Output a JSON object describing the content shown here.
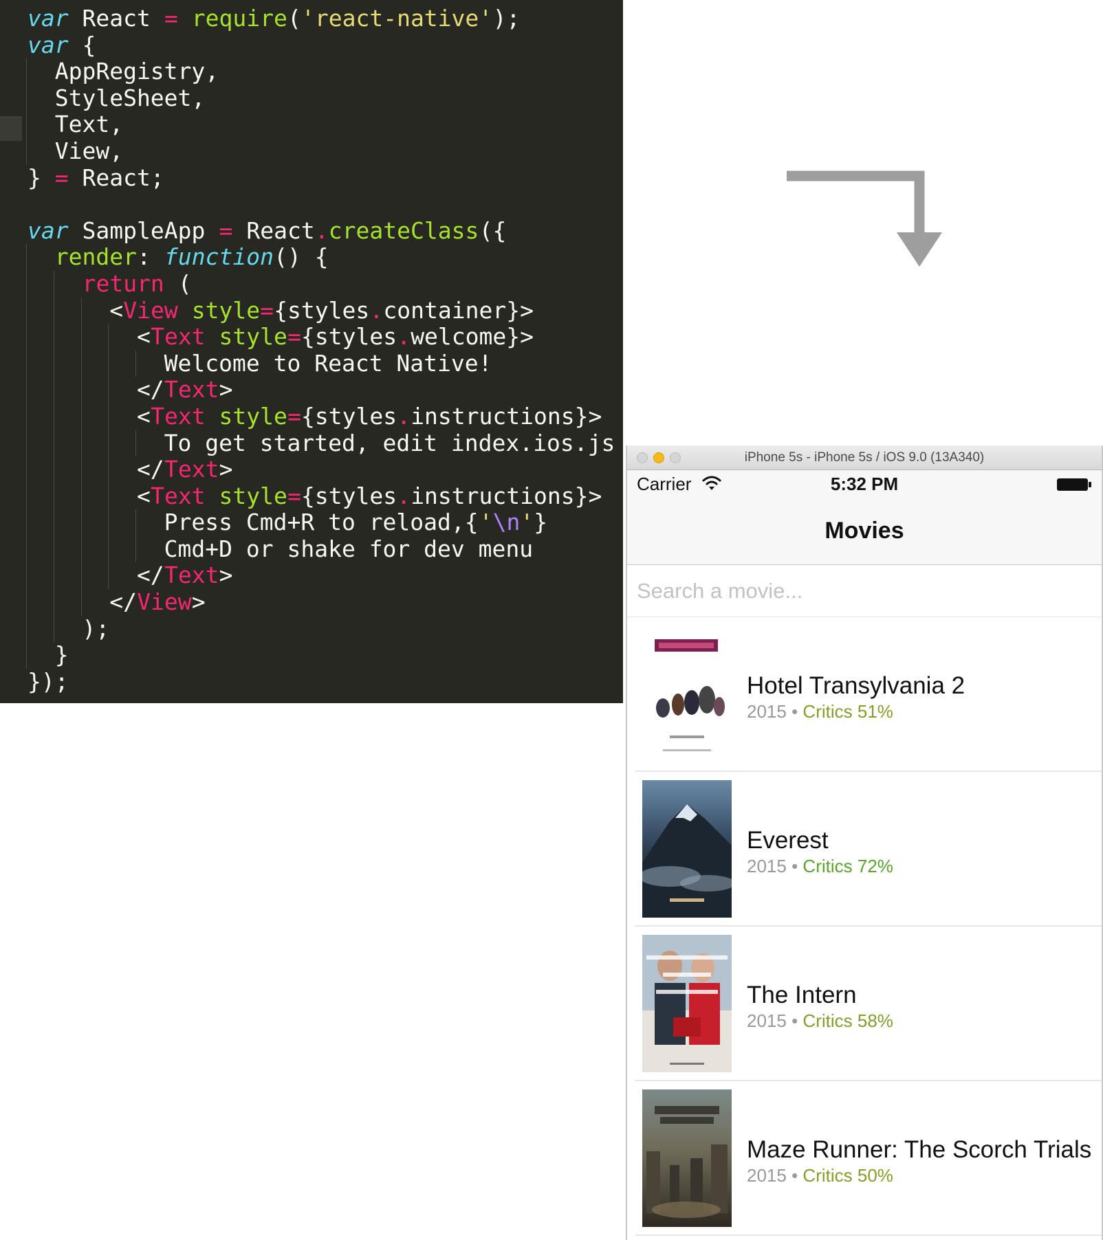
{
  "editor": {
    "lines": [
      [
        {
          "t": "var",
          "c": "kw-it"
        },
        {
          "t": " React ",
          "c": "plain"
        },
        {
          "t": "=",
          "c": "op"
        },
        {
          "t": " require",
          "c": "fn"
        },
        {
          "t": "(",
          "c": "plain"
        },
        {
          "t": "'react-native'",
          "c": "str"
        },
        {
          "t": ");",
          "c": "plain"
        }
      ],
      [
        {
          "t": "var",
          "c": "kw-it"
        },
        {
          "t": " {",
          "c": "plain"
        }
      ],
      [
        {
          "t": "  AppRegistry,",
          "c": "plain"
        }
      ],
      [
        {
          "t": "  StyleSheet,",
          "c": "plain"
        }
      ],
      [
        {
          "t": "  Text,",
          "c": "plain"
        }
      ],
      [
        {
          "t": "  View,",
          "c": "plain"
        }
      ],
      [
        {
          "t": "} ",
          "c": "plain"
        },
        {
          "t": "=",
          "c": "op"
        },
        {
          "t": " React;",
          "c": "plain"
        }
      ],
      [
        {
          "t": "",
          "c": "plain"
        }
      ],
      [
        {
          "t": "var",
          "c": "kw-it"
        },
        {
          "t": " SampleApp ",
          "c": "plain"
        },
        {
          "t": "=",
          "c": "op"
        },
        {
          "t": " React",
          "c": "plain"
        },
        {
          "t": ".",
          "c": "op"
        },
        {
          "t": "createClass",
          "c": "fn"
        },
        {
          "t": "({",
          "c": "plain"
        }
      ],
      [
        {
          "t": "  ",
          "c": "plain"
        },
        {
          "t": "render",
          "c": "fn"
        },
        {
          "t": ": ",
          "c": "plain"
        },
        {
          "t": "function",
          "c": "kw-it"
        },
        {
          "t": "() {",
          "c": "plain"
        }
      ],
      [
        {
          "t": "    ",
          "c": "plain"
        },
        {
          "t": "return",
          "c": "kw"
        },
        {
          "t": " (",
          "c": "plain"
        }
      ],
      [
        {
          "t": "      <",
          "c": "plain"
        },
        {
          "t": "View",
          "c": "tag"
        },
        {
          "t": " style",
          "c": "attr"
        },
        {
          "t": "=",
          "c": "op"
        },
        {
          "t": "{styles",
          "c": "plain"
        },
        {
          "t": ".",
          "c": "op"
        },
        {
          "t": "container}>",
          "c": "plain"
        }
      ],
      [
        {
          "t": "        <",
          "c": "plain"
        },
        {
          "t": "Text",
          "c": "tag"
        },
        {
          "t": " style",
          "c": "attr"
        },
        {
          "t": "=",
          "c": "op"
        },
        {
          "t": "{styles",
          "c": "plain"
        },
        {
          "t": ".",
          "c": "op"
        },
        {
          "t": "welcome}>",
          "c": "plain"
        }
      ],
      [
        {
          "t": "          Welcome to React Native!",
          "c": "plain"
        }
      ],
      [
        {
          "t": "        </",
          "c": "plain"
        },
        {
          "t": "Text",
          "c": "tag"
        },
        {
          "t": ">",
          "c": "plain"
        }
      ],
      [
        {
          "t": "        <",
          "c": "plain"
        },
        {
          "t": "Text",
          "c": "tag"
        },
        {
          "t": " style",
          "c": "attr"
        },
        {
          "t": "=",
          "c": "op"
        },
        {
          "t": "{styles",
          "c": "plain"
        },
        {
          "t": ".",
          "c": "op"
        },
        {
          "t": "instructions}>",
          "c": "plain"
        }
      ],
      [
        {
          "t": "          To get started, edit index.ios.js",
          "c": "plain"
        }
      ],
      [
        {
          "t": "        </",
          "c": "plain"
        },
        {
          "t": "Text",
          "c": "tag"
        },
        {
          "t": ">",
          "c": "plain"
        }
      ],
      [
        {
          "t": "        <",
          "c": "plain"
        },
        {
          "t": "Text",
          "c": "tag"
        },
        {
          "t": " style",
          "c": "attr"
        },
        {
          "t": "=",
          "c": "op"
        },
        {
          "t": "{styles",
          "c": "plain"
        },
        {
          "t": ".",
          "c": "op"
        },
        {
          "t": "instructions}>",
          "c": "plain"
        }
      ],
      [
        {
          "t": "          Press Cmd+R to reload,{",
          "c": "plain"
        },
        {
          "t": "'",
          "c": "str"
        },
        {
          "t": "\\n",
          "c": "esc"
        },
        {
          "t": "'",
          "c": "str"
        },
        {
          "t": "}",
          "c": "plain"
        }
      ],
      [
        {
          "t": "          Cmd+D or shake for dev menu",
          "c": "plain"
        }
      ],
      [
        {
          "t": "        </",
          "c": "plain"
        },
        {
          "t": "Text",
          "c": "tag"
        },
        {
          "t": ">",
          "c": "plain"
        }
      ],
      [
        {
          "t": "      </",
          "c": "plain"
        },
        {
          "t": "View",
          "c": "tag"
        },
        {
          "t": ">",
          "c": "plain"
        }
      ],
      [
        {
          "t": "    );",
          "c": "plain"
        }
      ],
      [
        {
          "t": "  }",
          "c": "plain"
        }
      ],
      [
        {
          "t": "});",
          "c": "plain"
        }
      ]
    ]
  },
  "simulator": {
    "window_title": "iPhone 5s - iPhone 5s / iOS 9.0 (13A340)",
    "status": {
      "carrier": "Carrier",
      "time": "5:32 PM"
    },
    "nav_title": "Movies",
    "search": {
      "placeholder": "Search a movie...",
      "value": ""
    },
    "movies": [
      {
        "title": "Hotel Transylvania 2",
        "year": "2015",
        "separator": "•",
        "critics": "Critics 51%",
        "critics_color": "#8a9a2c",
        "poster": "hotel"
      },
      {
        "title": "Everest",
        "year": "2015",
        "separator": "•",
        "critics": "Critics 72%",
        "critics_color": "#5aa32f",
        "poster": "everest"
      },
      {
        "title": "The Intern",
        "year": "2015",
        "separator": "•",
        "critics": "Critics 58%",
        "critics_color": "#7f9e2e",
        "poster": "intern"
      },
      {
        "title": "Maze Runner: The Scorch Trials",
        "year": "2015",
        "separator": "•",
        "critics": "Critics 50%",
        "critics_color": "#8a9a2c",
        "poster": "maze"
      }
    ]
  },
  "colors": {
    "editor_bg": "#272822",
    "accent_pink": "#f92672",
    "accent_green": "#a6e22e",
    "accent_cyan": "#66d9ef",
    "arrow": "#9e9e9e"
  },
  "icons": {
    "arrow": "down-turn-arrow-icon",
    "wifi": "wifi-icon",
    "battery": "battery-icon"
  }
}
